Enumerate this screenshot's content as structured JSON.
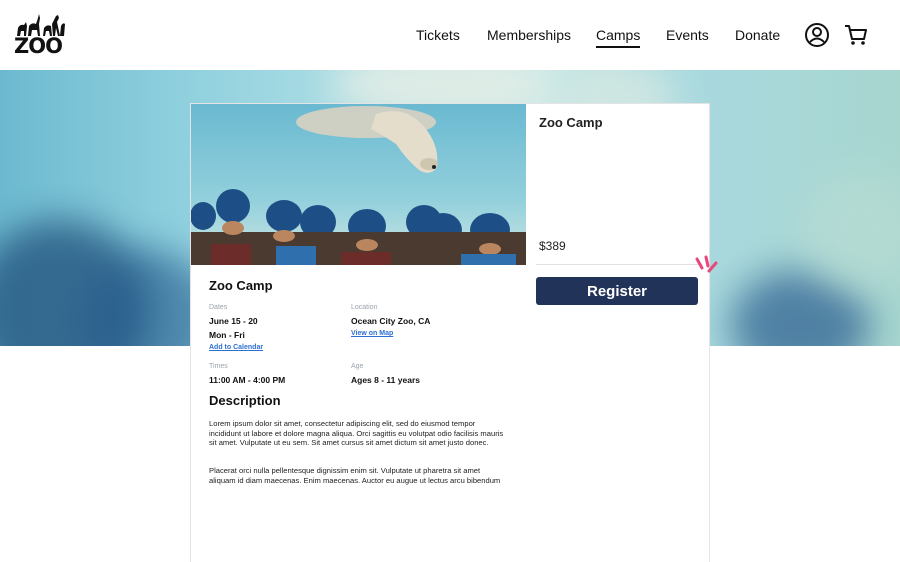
{
  "header": {
    "logo_text": "ZOO",
    "nav": [
      {
        "label": "Tickets",
        "active": false
      },
      {
        "label": "Memberships",
        "active": false
      },
      {
        "label": "Camps",
        "active": true
      },
      {
        "label": "Events",
        "active": false
      },
      {
        "label": "Donate",
        "active": false
      }
    ],
    "icons": {
      "account": "user-circle-icon",
      "cart": "shopping-cart-icon"
    }
  },
  "product": {
    "title": "Zoo Camp",
    "price": "$389",
    "register_label": "Register"
  },
  "details": {
    "title": "Zoo Camp",
    "dates_label": "Dates",
    "dates_value": "June 15 - 20",
    "days_value": "Mon - Fri",
    "calendar_link": "Add to Calendar",
    "location_label": "Location",
    "location_value": "Ocean City Zoo, CA",
    "map_link": "View on Map",
    "times_label": "Times",
    "times_value": "11:00 AM - 4:00 PM",
    "age_label": "Age",
    "age_value": "Ages 8 - 11 years"
  },
  "description": {
    "title": "Description",
    "paragraphs": [
      "Lorem ipsum dolor sit amet, consectetur adipiscing elit, sed do eiusmod tempor incididunt ut labore et dolore magna aliqua. Orci sagittis eu volutpat odio facilisis mauris sit amet. Vulputate ut eu sem. Sit amet cursus sit amet dictum sit amet justo donec.",
      "Placerat orci nulla pellentesque dignissim enim sit. Vulputate ut pharetra sit amet aliquam id diam maecenas. Enim maecenas. Auctor eu augue ut lectus arcu bibendum"
    ]
  },
  "colors": {
    "accent": "#22335a",
    "link": "#2d6fd1",
    "sparkle": "#e8477a"
  }
}
